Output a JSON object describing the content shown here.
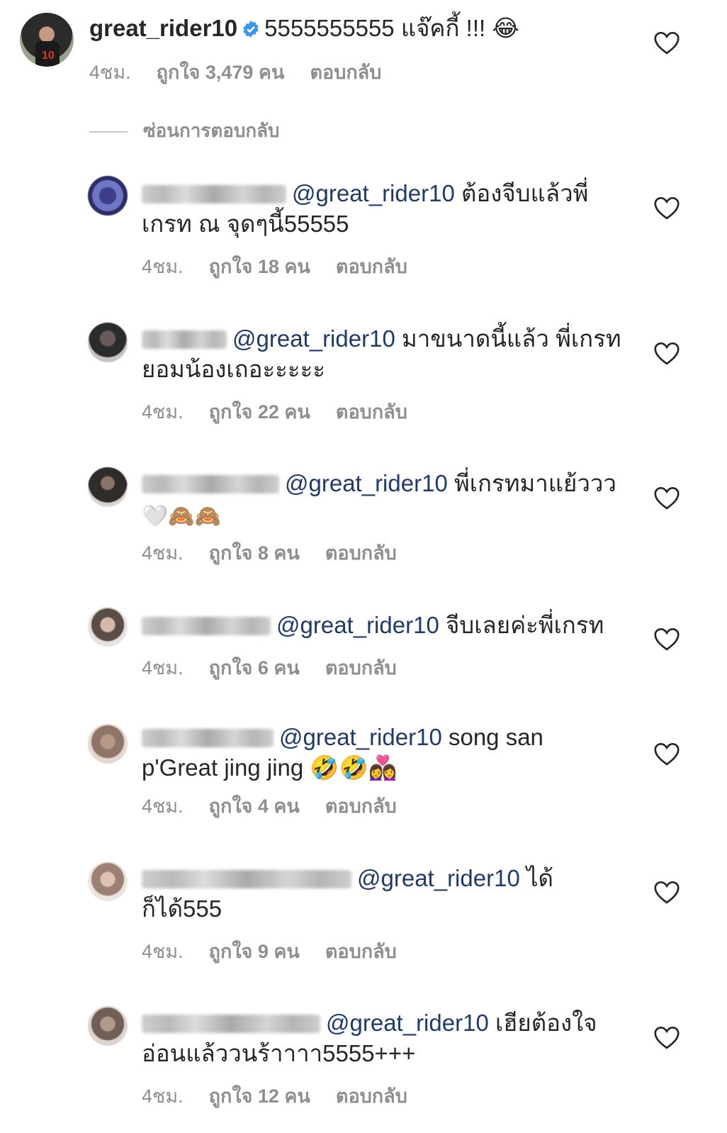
{
  "main_comment": {
    "username": "great_rider10",
    "text": "5555555555 แจ๊คกี้ !!! 😂",
    "time": "4ชม.",
    "likes": "ถูกใจ 3,479 คน",
    "reply": "ตอบกลับ"
  },
  "hide_replies": "ซ่อนการตอบกลับ",
  "replies": [
    {
      "mention": "@great_rider10",
      "line1": " ต้องจีบแล้วพี่",
      "line2": "เกรท ณ จุดๆนี้55555",
      "time": "4ชม.",
      "likes": "ถูกใจ 18 คน",
      "reply": "ตอบกลับ"
    },
    {
      "mention": "@great_rider10",
      "line1": " มาขนาดนี้แล้ว พี่เกรท",
      "line2": "ยอมน้องเถอะะะะะ",
      "time": "4ชม.",
      "likes": "ถูกใจ 22 คน",
      "reply": "ตอบกลับ"
    },
    {
      "mention": "@great_rider10",
      "line1": " พี่เกรทมาแย้ววว",
      "line2": "🤍🙈🙈",
      "time": "4ชม.",
      "likes": "ถูกใจ 8 คน",
      "reply": "ตอบกลับ"
    },
    {
      "mention": "@great_rider10",
      "line1": " จีบเลยค่ะพี่เกรท",
      "line2": "",
      "time": "4ชม.",
      "likes": "ถูกใจ 6 คน",
      "reply": "ตอบกลับ"
    },
    {
      "mention": "@great_rider10",
      "line1": " song san",
      "line2": "p'Great jing jing 🤣🤣👩‍❤️‍👩",
      "time": "4ชม.",
      "likes": "ถูกใจ 4 คน",
      "reply": "ตอบกลับ"
    },
    {
      "mention": "@great_rider10",
      "line1": " ได้",
      "line2": "ก็ได้555",
      "time": "4ชม.",
      "likes": "ถูกใจ 9 คน",
      "reply": "ตอบกลับ"
    },
    {
      "mention": "@great_rider10",
      "line1": " เฮียต้องใจ",
      "line2": "อ่อนแล้ววนร้าาาา5555+++",
      "time": "4ชม.",
      "likes": "ถูกใจ 12 คน",
      "reply": "ตอบกลับ"
    }
  ],
  "colors": {
    "mention": "#1f3a6b",
    "meta": "#8e8e8e",
    "verified": "#3897f0"
  }
}
